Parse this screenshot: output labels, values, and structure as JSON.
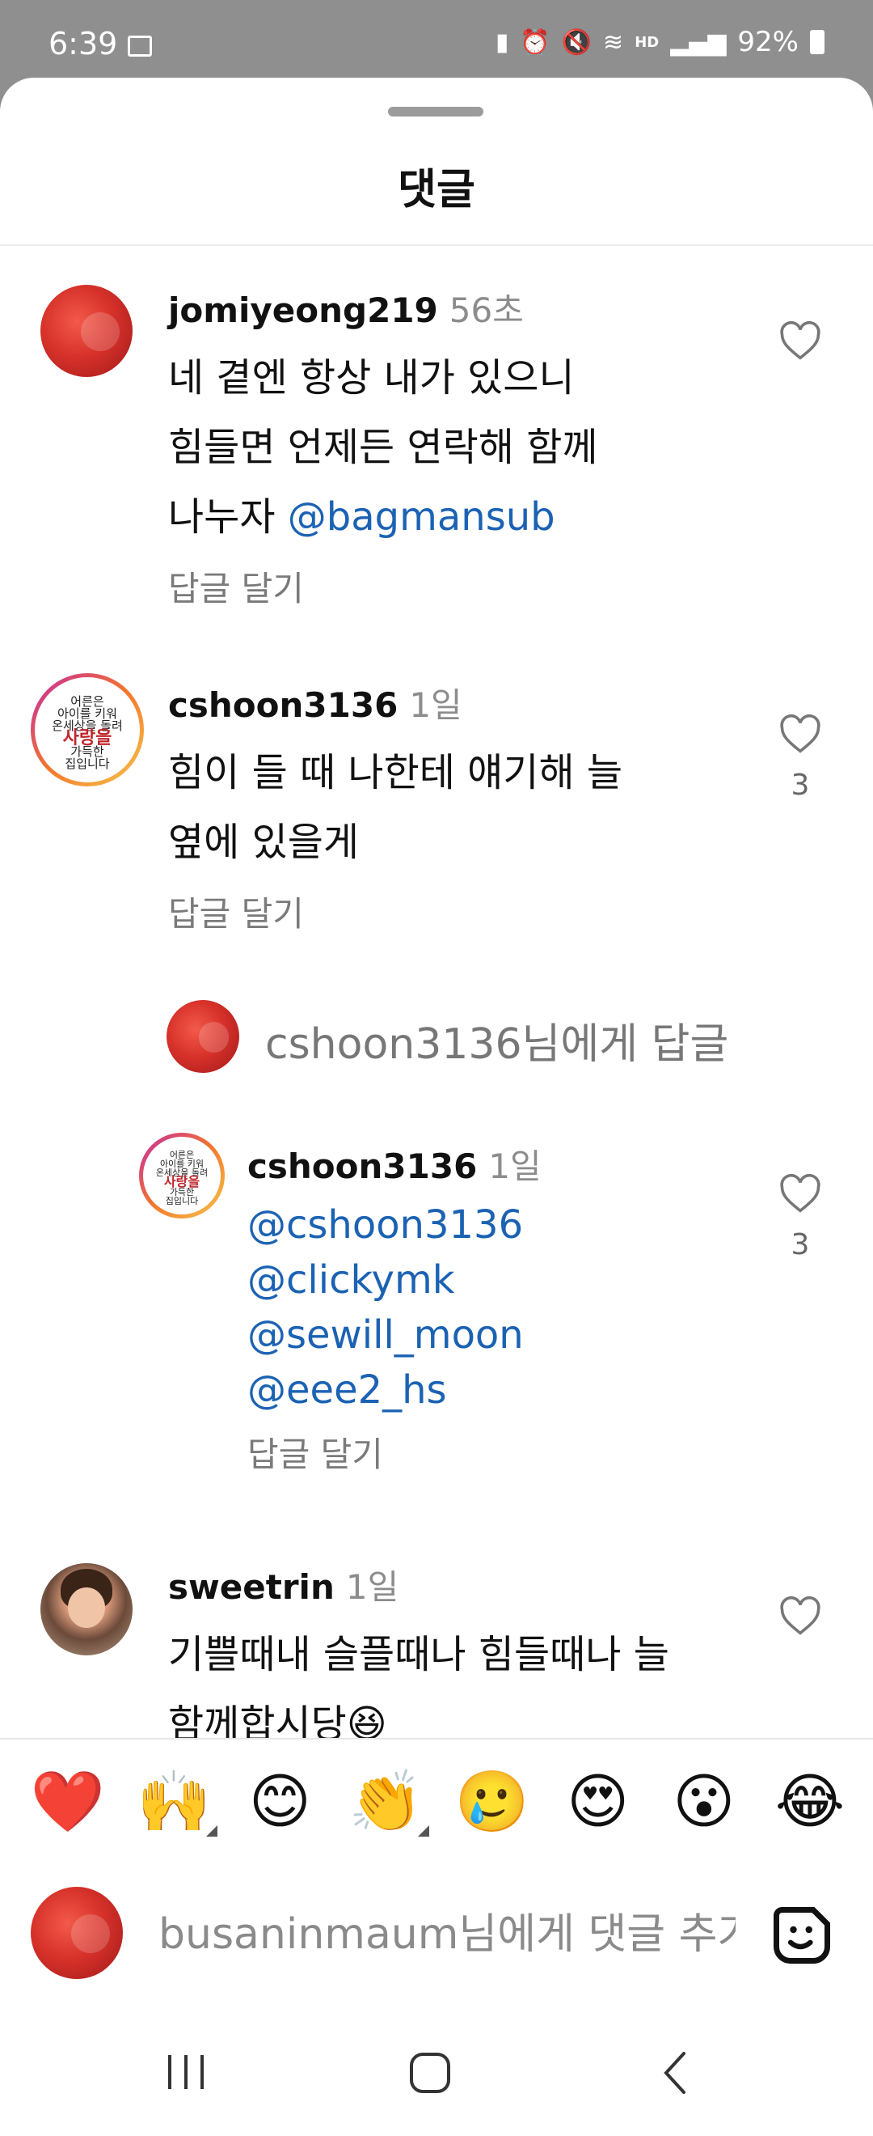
{
  "status_bar": {
    "time": "6:39",
    "hd_label": "HD",
    "battery": "92%"
  },
  "sheet": {
    "title": "댓글"
  },
  "comments": [
    {
      "username": "jomiyeong219",
      "time": "56초",
      "lines": [
        "네 곁엔 항상 내가 있으니",
        "힘들면 언제든 연락해 함께",
        "나누자 "
      ],
      "mention": "@bagmansub",
      "reply": "답글 달기",
      "likes": ""
    },
    {
      "username": "cshoon3136",
      "time": "1일",
      "lines": [
        "힘이 들 때 나한테 얘기해 늘",
        "옆에 있을게"
      ],
      "reply": "답글 달기",
      "likes": "3"
    },
    {
      "username": "cshoon3136",
      "time": "1일",
      "mentions": [
        "@cshoon3136",
        "@clickymk",
        "@sewill_moon",
        "@eee2_hs"
      ],
      "reply": "답글 달기",
      "likes": "3"
    },
    {
      "username": "sweetrin",
      "time": "1일",
      "lines": [
        "기쁠때내 슬플때나 힘들때나 늘",
        "함께합시당😆"
      ],
      "likes": ""
    }
  ],
  "reply_thread": {
    "placeholder": "cshoon3136님에게 답글"
  },
  "calligraphy": {
    "lines": [
      "어른은",
      "아이를 키워",
      "온세상을 돌려",
      "사랑을",
      "가득한",
      "집입니다"
    ]
  },
  "emoji_bar": [
    "❤️",
    "🙌",
    "😊",
    "👏",
    "🥲",
    "😍",
    "😮",
    "😂"
  ],
  "composer": {
    "placeholder": "busaninmaum님에게 댓글 추가..."
  },
  "colors": {
    "mention": "#1b62b3",
    "accent_red": "#d7322a"
  }
}
